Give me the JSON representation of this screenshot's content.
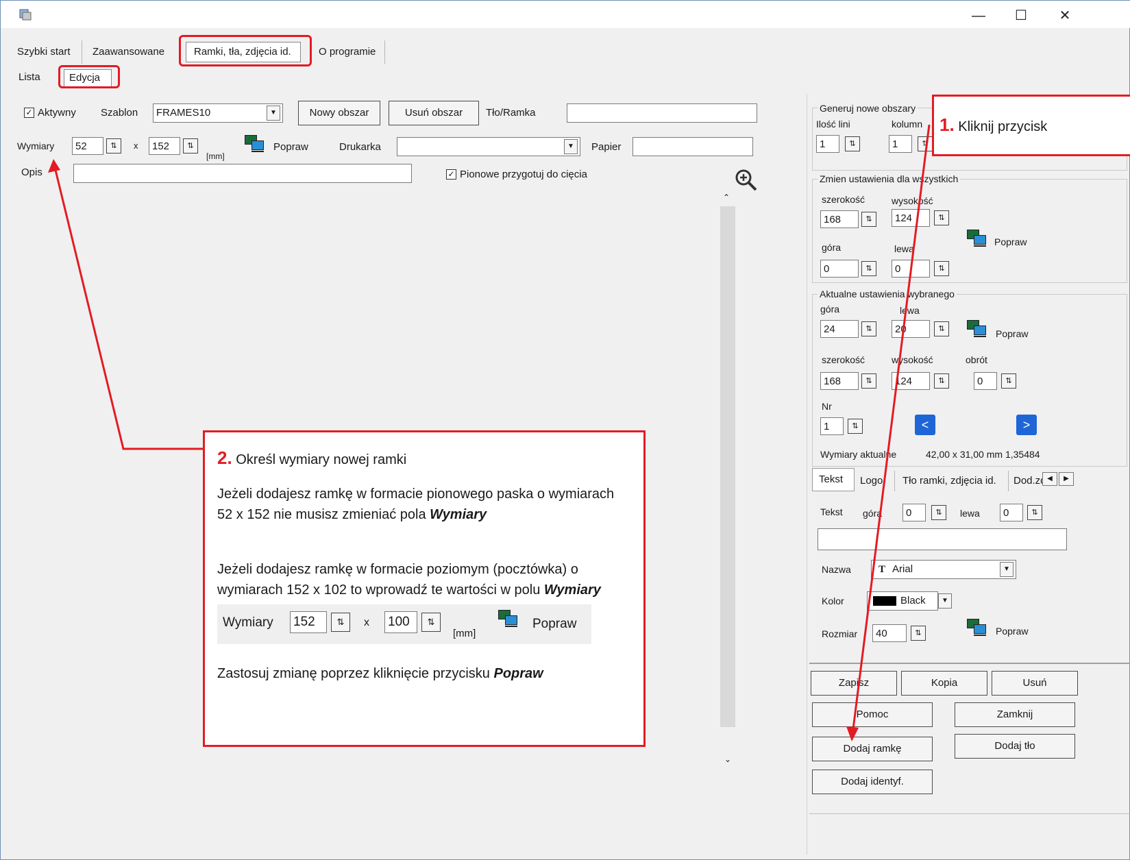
{
  "window": {
    "minimize": "—",
    "maximize": "☐",
    "close": "✕"
  },
  "tabs": [
    "Szybki start",
    "Zaawansowane",
    "Ramki, tła, zdjęcia id.",
    "O programie"
  ],
  "subtabs": [
    "Lista",
    "Edycja"
  ],
  "form": {
    "active_label": "Aktywny",
    "template_label": "Szablon",
    "template_value": "FRAMES10",
    "new_area": "Nowy obszar",
    "delete_area": "Usuń obszar",
    "bg_frame_label": "Tło/Ramka",
    "bg_frame_value": "",
    "dimensions_label": "Wymiary",
    "width_value": "52",
    "x_sign": "x",
    "height_value": "152",
    "unit": "[mm]",
    "fix": "Popraw",
    "printer_label": "Drukarka",
    "printer_value": "",
    "paper_label": "Papier",
    "paper_value": "",
    "desc_label": "Opis",
    "desc_value": "",
    "vertical_cut": "Pionowe przygotuj do cięcia"
  },
  "right": {
    "gen_group": "Generuj nowe obszary",
    "lines_label": "Ilość lini",
    "cols_label": "kolumn",
    "lines_value": "1",
    "cols_value": "1",
    "all_group": "Zmien ustawienia dla wszystkich",
    "width_label": "szerokość",
    "height_label": "wysokość",
    "all_width": "168",
    "all_height": "124",
    "top_label": "góra",
    "left_label": "lewa",
    "all_top": "0",
    "all_left": "0",
    "popraw": "Popraw",
    "cur_group": "Aktualne ustawienia wybranego",
    "cur_top": "24",
    "cur_left": "20",
    "cur_width": "168",
    "cur_height": "124",
    "rotation_label": "obrót",
    "cur_rotation": "0",
    "nr_label": "Nr",
    "nr_value": "1",
    "prev": "<",
    "next": ">",
    "current_dims_label": "Wymiary aktualne",
    "current_dims_value": "42,00 x 31,00 mm 1,35484",
    "subtabs": [
      "Tekst",
      "Logo",
      "Tło ramki, zdjęcia id.",
      "Dod.zd"
    ],
    "text_label": "Tekst",
    "text_top_label": "góra",
    "text_top": "0",
    "text_left_label": "lewa",
    "text_left": "0",
    "text_value": "",
    "name_label": "Nazwa",
    "font_icon": "T",
    "font_value": "Arial",
    "color_label": "Kolor",
    "color_value": "Black",
    "size_label": "Rozmiar",
    "size_value": "40",
    "save": "Zapisz",
    "copy": "Kopia",
    "delete": "Usuń",
    "help": "Pomoc",
    "close": "Zamknij",
    "add_frame": "Dodaj ramkę",
    "add_bg": "Dodaj tło",
    "add_id": "Dodaj identyf."
  },
  "callout1": {
    "num": "1.",
    "text": "Kliknij przycisk"
  },
  "callout2": {
    "num": "2.",
    "title": "Określ wymiary nowej ramki",
    "p1a": "Jeżeli dodajesz ramkę w formacie pionowego paska o wymiarach 52 x 152 nie musisz zmieniać pola ",
    "p1b": "Wymiary",
    "p2a": "Jeżeli dodajesz ramkę w formacie poziomym (pocztówka) o wymiarach 152 x 102 to wprowadź te wartości w polu ",
    "p2b": "Wymiary",
    "ex_label": "Wymiary",
    "ex_w": "152",
    "ex_x": "x",
    "ex_h": "100",
    "ex_unit": "[mm]",
    "ex_fix": "Popraw",
    "p3a": "Zastosuj zmianę poprzez kliknięcie przycisku ",
    "p3b": "Popraw"
  },
  "colors": {
    "annotation": "#e31b23",
    "nav_blue": "#1e66d6"
  }
}
